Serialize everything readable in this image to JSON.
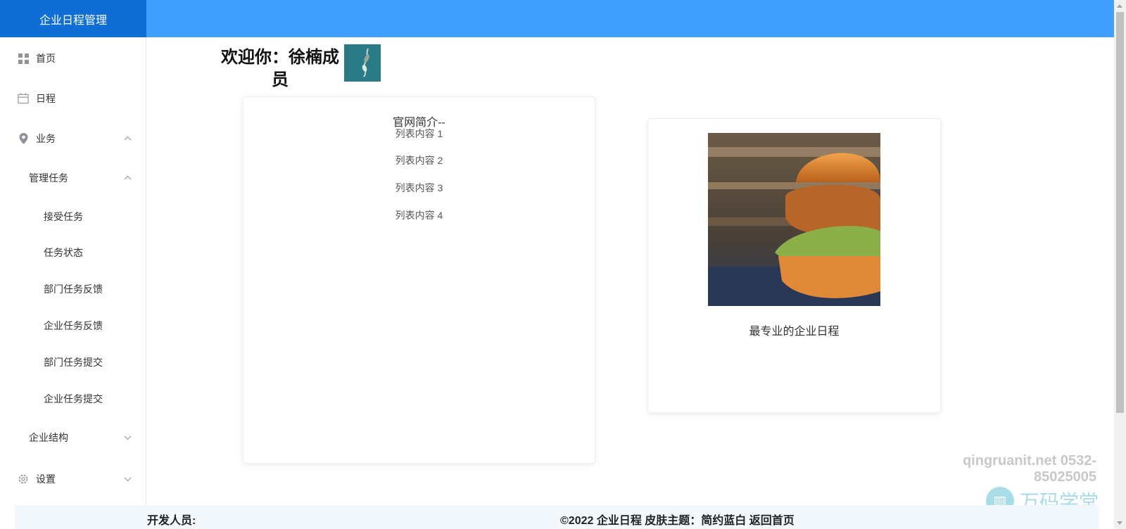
{
  "app": {
    "brand": "企业日程管理"
  },
  "sidebar": {
    "items": [
      {
        "label": "首页",
        "icon": "grid-icon"
      },
      {
        "label": "日程",
        "icon": "calendar-icon"
      },
      {
        "label": "业务",
        "icon": "location-icon",
        "expanded": true
      },
      {
        "label": "管理任务",
        "expanded": true
      },
      {
        "label": "接受任务"
      },
      {
        "label": "任务状态"
      },
      {
        "label": "部门任务反馈"
      },
      {
        "label": "企业任务反馈"
      },
      {
        "label": "部门任务提交"
      },
      {
        "label": "企业任务提交"
      },
      {
        "label": "企业结构",
        "expanded": false
      },
      {
        "label": "设置",
        "icon": "gear-icon",
        "expanded": false
      }
    ]
  },
  "main": {
    "welcome": "欢迎你：徐楠成员",
    "intro": {
      "title": "官网简介--",
      "items": [
        "列表内容 1",
        "列表内容 2",
        "列表内容 3",
        "列表内容 4"
      ]
    },
    "feature": {
      "caption": "最专业的企业日程"
    }
  },
  "watermark": {
    "text": "qingruanit.net 0532-85025005",
    "logo_text": "万码学堂"
  },
  "footer": {
    "developers": "开发人员:",
    "copyright": "©2022 企业日程 皮肤主题：简约蓝白 返回首页"
  },
  "colors": {
    "header": "#409eff",
    "brand": "#0e6ed6",
    "footer": "#f3f8fc"
  }
}
